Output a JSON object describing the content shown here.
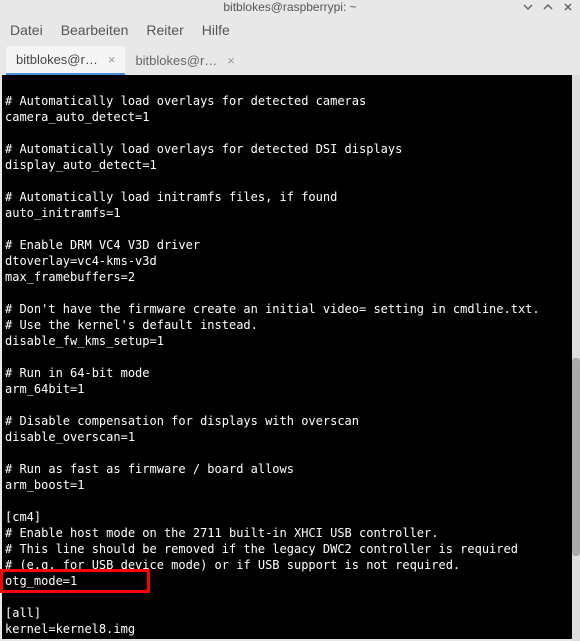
{
  "window": {
    "title": "bitblokes@raspberrypi: ~"
  },
  "menubar": {
    "file": "Datei",
    "edit": "Bearbeiten",
    "tabs": "Reiter",
    "help": "Hilfe"
  },
  "tabs": [
    {
      "label": "bitblokes@r…",
      "active": true
    },
    {
      "label": "bitblokes@r…",
      "active": false
    }
  ],
  "terminal_lines": [
    "",
    "# Automatically load overlays for detected cameras",
    "camera_auto_detect=1",
    "",
    "# Automatically load overlays for detected DSI displays",
    "display_auto_detect=1",
    "",
    "# Automatically load initramfs files, if found",
    "auto_initramfs=1",
    "",
    "# Enable DRM VC4 V3D driver",
    "dtoverlay=vc4-kms-v3d",
    "max_framebuffers=2",
    "",
    "# Don't have the firmware create an initial video= setting in cmdline.txt.",
    "# Use the kernel's default instead.",
    "disable_fw_kms_setup=1",
    "",
    "# Run in 64-bit mode",
    "arm_64bit=1",
    "",
    "# Disable compensation for displays with overscan",
    "disable_overscan=1",
    "",
    "# Run as fast as firmware / board allows",
    "arm_boost=1",
    "",
    "[cm4]",
    "# Enable host mode on the 2711 built-in XHCI USB controller.",
    "# This line should be removed if the legacy DWC2 controller is required",
    "# (e.g. for USB device mode) or if USB support is not required.",
    "otg_mode=1",
    "",
    "[all]",
    "kernel=kernel8.img"
  ],
  "highlight": {
    "color": "#ff0000"
  },
  "close_symbol": "×"
}
